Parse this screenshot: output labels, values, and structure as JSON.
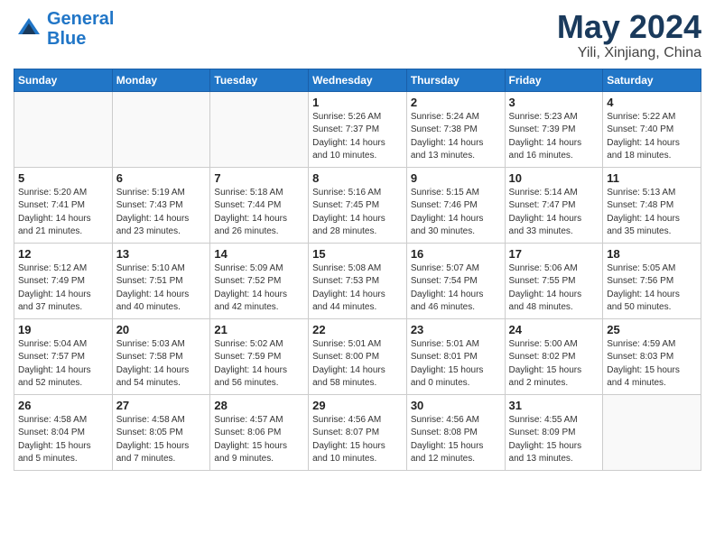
{
  "header": {
    "logo_line1": "General",
    "logo_line2": "Blue",
    "title": "May 2024",
    "location": "Yili, Xinjiang, China"
  },
  "weekdays": [
    "Sunday",
    "Monday",
    "Tuesday",
    "Wednesday",
    "Thursday",
    "Friday",
    "Saturday"
  ],
  "weeks": [
    [
      {
        "day": "",
        "info": ""
      },
      {
        "day": "",
        "info": ""
      },
      {
        "day": "",
        "info": ""
      },
      {
        "day": "1",
        "info": "Sunrise: 5:26 AM\nSunset: 7:37 PM\nDaylight: 14 hours\nand 10 minutes."
      },
      {
        "day": "2",
        "info": "Sunrise: 5:24 AM\nSunset: 7:38 PM\nDaylight: 14 hours\nand 13 minutes."
      },
      {
        "day": "3",
        "info": "Sunrise: 5:23 AM\nSunset: 7:39 PM\nDaylight: 14 hours\nand 16 minutes."
      },
      {
        "day": "4",
        "info": "Sunrise: 5:22 AM\nSunset: 7:40 PM\nDaylight: 14 hours\nand 18 minutes."
      }
    ],
    [
      {
        "day": "5",
        "info": "Sunrise: 5:20 AM\nSunset: 7:41 PM\nDaylight: 14 hours\nand 21 minutes."
      },
      {
        "day": "6",
        "info": "Sunrise: 5:19 AM\nSunset: 7:43 PM\nDaylight: 14 hours\nand 23 minutes."
      },
      {
        "day": "7",
        "info": "Sunrise: 5:18 AM\nSunset: 7:44 PM\nDaylight: 14 hours\nand 26 minutes."
      },
      {
        "day": "8",
        "info": "Sunrise: 5:16 AM\nSunset: 7:45 PM\nDaylight: 14 hours\nand 28 minutes."
      },
      {
        "day": "9",
        "info": "Sunrise: 5:15 AM\nSunset: 7:46 PM\nDaylight: 14 hours\nand 30 minutes."
      },
      {
        "day": "10",
        "info": "Sunrise: 5:14 AM\nSunset: 7:47 PM\nDaylight: 14 hours\nand 33 minutes."
      },
      {
        "day": "11",
        "info": "Sunrise: 5:13 AM\nSunset: 7:48 PM\nDaylight: 14 hours\nand 35 minutes."
      }
    ],
    [
      {
        "day": "12",
        "info": "Sunrise: 5:12 AM\nSunset: 7:49 PM\nDaylight: 14 hours\nand 37 minutes."
      },
      {
        "day": "13",
        "info": "Sunrise: 5:10 AM\nSunset: 7:51 PM\nDaylight: 14 hours\nand 40 minutes."
      },
      {
        "day": "14",
        "info": "Sunrise: 5:09 AM\nSunset: 7:52 PM\nDaylight: 14 hours\nand 42 minutes."
      },
      {
        "day": "15",
        "info": "Sunrise: 5:08 AM\nSunset: 7:53 PM\nDaylight: 14 hours\nand 44 minutes."
      },
      {
        "day": "16",
        "info": "Sunrise: 5:07 AM\nSunset: 7:54 PM\nDaylight: 14 hours\nand 46 minutes."
      },
      {
        "day": "17",
        "info": "Sunrise: 5:06 AM\nSunset: 7:55 PM\nDaylight: 14 hours\nand 48 minutes."
      },
      {
        "day": "18",
        "info": "Sunrise: 5:05 AM\nSunset: 7:56 PM\nDaylight: 14 hours\nand 50 minutes."
      }
    ],
    [
      {
        "day": "19",
        "info": "Sunrise: 5:04 AM\nSunset: 7:57 PM\nDaylight: 14 hours\nand 52 minutes."
      },
      {
        "day": "20",
        "info": "Sunrise: 5:03 AM\nSunset: 7:58 PM\nDaylight: 14 hours\nand 54 minutes."
      },
      {
        "day": "21",
        "info": "Sunrise: 5:02 AM\nSunset: 7:59 PM\nDaylight: 14 hours\nand 56 minutes."
      },
      {
        "day": "22",
        "info": "Sunrise: 5:01 AM\nSunset: 8:00 PM\nDaylight: 14 hours\nand 58 minutes."
      },
      {
        "day": "23",
        "info": "Sunrise: 5:01 AM\nSunset: 8:01 PM\nDaylight: 15 hours\nand 0 minutes."
      },
      {
        "day": "24",
        "info": "Sunrise: 5:00 AM\nSunset: 8:02 PM\nDaylight: 15 hours\nand 2 minutes."
      },
      {
        "day": "25",
        "info": "Sunrise: 4:59 AM\nSunset: 8:03 PM\nDaylight: 15 hours\nand 4 minutes."
      }
    ],
    [
      {
        "day": "26",
        "info": "Sunrise: 4:58 AM\nSunset: 8:04 PM\nDaylight: 15 hours\nand 5 minutes."
      },
      {
        "day": "27",
        "info": "Sunrise: 4:58 AM\nSunset: 8:05 PM\nDaylight: 15 hours\nand 7 minutes."
      },
      {
        "day": "28",
        "info": "Sunrise: 4:57 AM\nSunset: 8:06 PM\nDaylight: 15 hours\nand 9 minutes."
      },
      {
        "day": "29",
        "info": "Sunrise: 4:56 AM\nSunset: 8:07 PM\nDaylight: 15 hours\nand 10 minutes."
      },
      {
        "day": "30",
        "info": "Sunrise: 4:56 AM\nSunset: 8:08 PM\nDaylight: 15 hours\nand 12 minutes."
      },
      {
        "day": "31",
        "info": "Sunrise: 4:55 AM\nSunset: 8:09 PM\nDaylight: 15 hours\nand 13 minutes."
      },
      {
        "day": "",
        "info": ""
      }
    ]
  ]
}
